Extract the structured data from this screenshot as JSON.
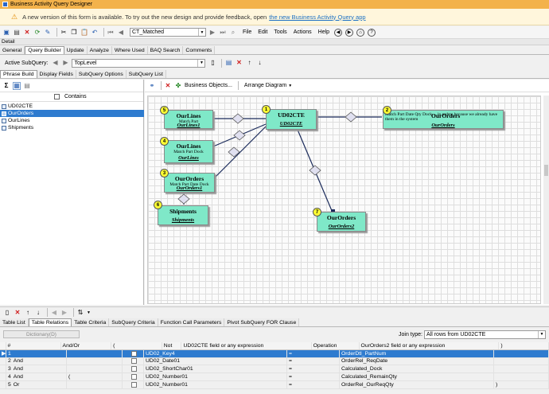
{
  "window": {
    "title": "Business Activity Query Designer"
  },
  "notice": {
    "text": "A new version of this form is available. To try out the new design and provide feedback, open",
    "link": "the new Business Activity Query app"
  },
  "toolbar": {
    "query_combo": "CT_Matched",
    "menus": [
      "File",
      "Edit",
      "Tools",
      "Actions",
      "Help"
    ]
  },
  "detail_label": "Detail",
  "main_tabs": [
    "General",
    "Query Builder",
    "Update",
    "Analyze",
    "Where Used",
    "BAQ Search",
    "Comments"
  ],
  "subquery": {
    "label": "Active SubQuery:",
    "value": "TopLevel"
  },
  "sub_tabs": [
    "Phrase Build",
    "Display Fields",
    "SubQuery Options",
    "SubQuery List"
  ],
  "left_panel": {
    "contains_label": "Contains",
    "tables": [
      "UD02CTE",
      "OurOrders",
      "OurLines",
      "Shipments"
    ],
    "selected_index": 1
  },
  "diagram_toolbar": {
    "business_objects": "Business Objects...",
    "arrange": "Arrange Diagram"
  },
  "nodes": [
    {
      "badge": "5",
      "title": "OurLines",
      "desc": "Match Part",
      "alias": "OurLines1"
    },
    {
      "badge": "1",
      "title": "UD02CTE",
      "desc": "",
      "alias": "UD02CTE"
    },
    {
      "badge": "2",
      "title": "OurOrders",
      "desc": "Match Part Date Qty Dock  ...  in orders because we already have them in the system",
      "alias": "OurOrders"
    },
    {
      "badge": "4",
      "title": "OurLines",
      "desc": "Match Part Dock",
      "alias": "OurLines"
    },
    {
      "badge": "3",
      "title": "OurOrders",
      "desc": "Match Part Date Dock",
      "alias": "OurOrders1"
    },
    {
      "badge": "6",
      "title": "Shipments",
      "desc": "",
      "alias": "Shipments"
    },
    {
      "badge": "7",
      "title": "OurOrders",
      "desc": "",
      "alias": "OurOrders2"
    }
  ],
  "bottom_tabs": [
    "Table List",
    "Table Relations",
    "Table Criteria",
    "SubQuery Criteria",
    "Function Call Parameters",
    "Pivot SubQuery FOR Clause"
  ],
  "bottom_active_tab": 1,
  "dictionary_button": "Dictionary(D)",
  "join": {
    "label": "Join type:",
    "value": "All rows from UD02CTE"
  },
  "grid": {
    "headers": [
      "#",
      "And/Or",
      "(",
      "Not",
      "UD02CTE field or any expression",
      "Operation",
      "OurOrders2 field or any expression",
      ")"
    ],
    "rows": [
      {
        "num": "1",
        "andor": "",
        "paren": "",
        "field": "UD02_Key4",
        "op": "=",
        "other": "OrderDtl_PartNum",
        "close": ""
      },
      {
        "num": "2",
        "andor": "And",
        "paren": "",
        "field": "UD02_Date01",
        "op": "=",
        "other": "OrderRel_ReqDate",
        "close": ""
      },
      {
        "num": "3",
        "andor": "And",
        "paren": "",
        "field": "UD02_ShortChar01",
        "op": "=",
        "other": "Calculated_Dock",
        "close": ""
      },
      {
        "num": "4",
        "andor": "And",
        "paren": "(",
        "field": "UD02_Number01",
        "op": "=",
        "other": "Calculated_RemainQty",
        "close": ""
      },
      {
        "num": "5",
        "andor": "Or",
        "paren": "",
        "field": "UD02_Number01",
        "op": "=",
        "other": "OrderRel_OurReqQty",
        "close": ")"
      }
    ],
    "selected_row": 0
  }
}
